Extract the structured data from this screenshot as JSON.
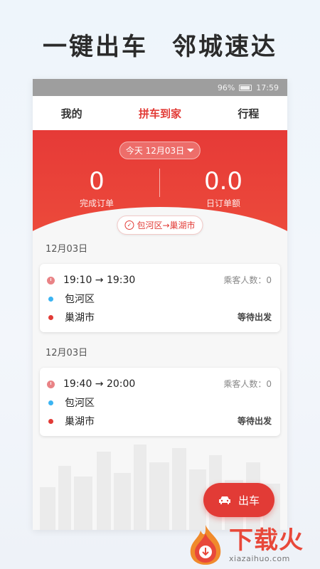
{
  "headline": {
    "part1": "一键出车",
    "part2": "邻城速达"
  },
  "status_bar": {
    "battery": "96%",
    "time": "17:59"
  },
  "tabs": [
    {
      "label": "我的",
      "active": false
    },
    {
      "label": "拼车到家",
      "active": true
    },
    {
      "label": "行程",
      "active": false
    }
  ],
  "summary": {
    "date_selector": "今天 12月03日",
    "completed_orders": {
      "value": "0",
      "label": "完成订单"
    },
    "daily_amount": {
      "value": "0.0",
      "label": "日订单额"
    },
    "route": "包河区→巢湖市"
  },
  "orders": [
    {
      "date": "12月03日",
      "time": "19:10 → 19:30",
      "passengers": "乘客人数：0",
      "from": "包河区",
      "to": "巢湖市",
      "status": "等待出发"
    },
    {
      "date": "12月03日",
      "time": "19:40 → 20:00",
      "passengers": "乘客人数：0",
      "from": "包河区",
      "to": "巢湖市",
      "status": "等待出发"
    }
  ],
  "depart_button": "出车",
  "watermark": {
    "name": "下载火",
    "url": "xiazaihuo.com"
  },
  "colors": {
    "accent": "#e23b36",
    "from_dot": "#3bb4f2",
    "to_dot": "#e23b36"
  }
}
